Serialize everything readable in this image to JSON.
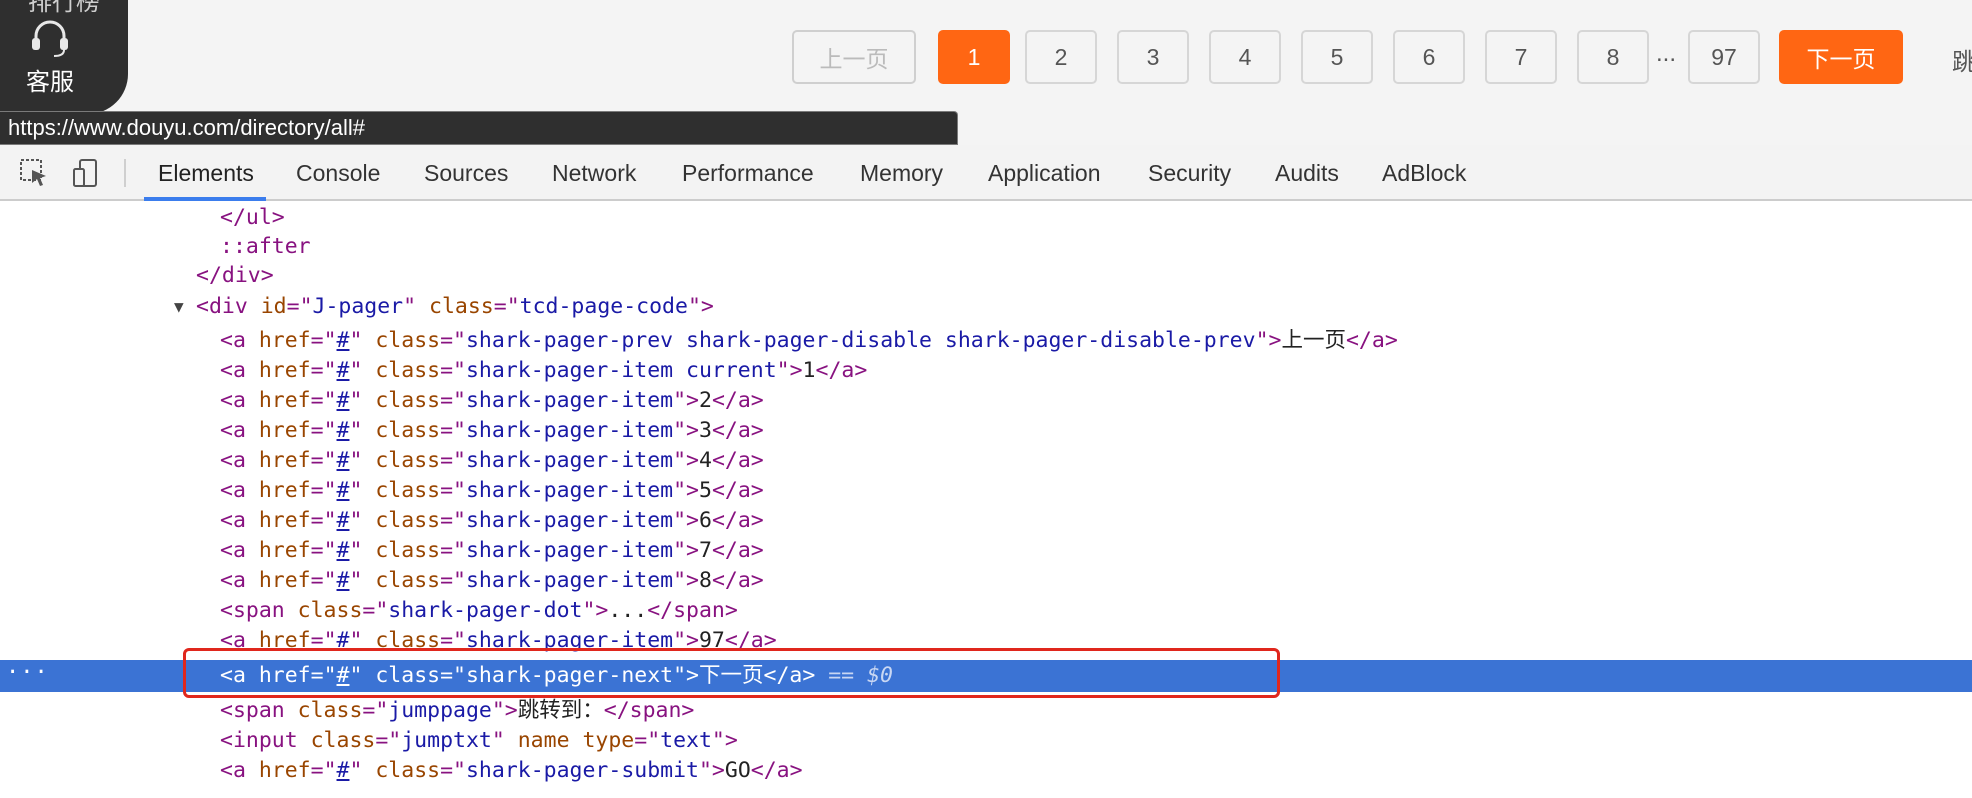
{
  "page": {
    "side_widget": {
      "rank_label": "排行榜",
      "service_label": "客服"
    },
    "pager": {
      "prev_label": "上一页",
      "pages": [
        "1",
        "2",
        "3",
        "4",
        "5",
        "6",
        "7",
        "8"
      ],
      "current": "1",
      "dots": "...",
      "last_page": "97",
      "next_label": "下一页",
      "jump_label": "跳"
    },
    "status_url": "https://www.douyu.com/directory/all#"
  },
  "devtools": {
    "tabs": [
      "Elements",
      "Console",
      "Sources",
      "Network",
      "Performance",
      "Memory",
      "Application",
      "Security",
      "Audits",
      "AdBlock"
    ],
    "active_tab": "Elements",
    "accent_color": "#3b7ded",
    "selection_color": "#3b73d4"
  },
  "dom": {
    "l1": "</ul>",
    "l2": "::after",
    "l3": "</div>",
    "div_open": {
      "tag": "<div",
      "id_attr": "id",
      "id_val": "J-pager",
      "class_attr": "class",
      "class_val": "tcd-page-code"
    },
    "href": "#",
    "item_class": "shark-pager-item",
    "prev_class": "shark-pager-prev shark-pager-disable shark-pager-disable-prev",
    "prev_text": "上一页",
    "current_class": "shark-pager-item current",
    "items": [
      "1",
      "2",
      "3",
      "4",
      "5",
      "6",
      "7",
      "8"
    ],
    "dot_class": "shark-pager-dot",
    "dot_text": "...",
    "last_item": "97",
    "next_class": "shark-pager-next",
    "next_text": "下一页",
    "selected_marker": "== $0",
    "jump_class": "jumppage",
    "jump_text": "跳转到：",
    "input_class": "jumptxt",
    "input_type": "text",
    "submit_class": "shark-pager-submit",
    "submit_text": "GO"
  }
}
